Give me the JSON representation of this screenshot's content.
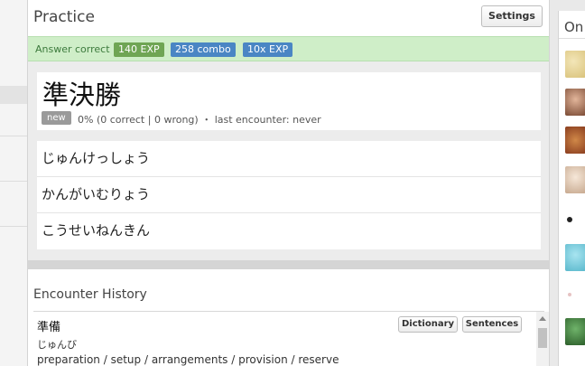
{
  "practice": {
    "title": "Practice",
    "settings_label": "Settings"
  },
  "status": {
    "text": "Answer correct",
    "exp": "140 EXP",
    "combo": "258 combo",
    "multiplier": "10x EXP",
    "accent_color": "#cfeec8"
  },
  "word": {
    "kanji": "準決勝",
    "badge": "new",
    "stats": "0% (0 correct | 0 wrong) ・ last encounter: never"
  },
  "choices": [
    "じゅんけっしょう",
    "かんがいむりょう",
    "こうせいねんきん"
  ],
  "encounter": {
    "title": "Encounter History",
    "word": "準備",
    "reading": "じゅんび",
    "meaning": "preparation / setup / arrangements / provision / reserve",
    "dictionary_label": "Dictionary",
    "sentences_label": "Sentences"
  },
  "online": {
    "title": "On"
  }
}
